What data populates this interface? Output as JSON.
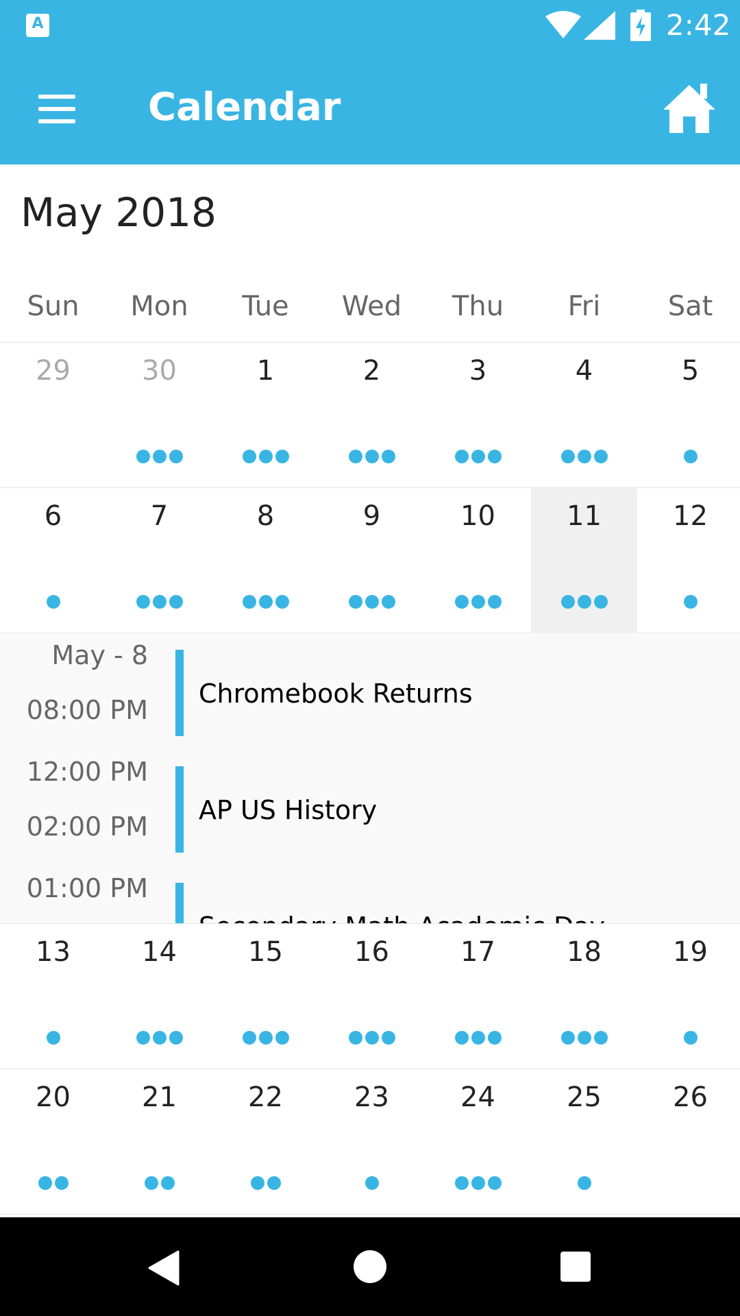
{
  "status_bar": {
    "app_icon_letter": "A",
    "time": "2:42",
    "icons": [
      "wifi-icon",
      "signal-icon",
      "battery-charging-icon"
    ]
  },
  "app_bar": {
    "title": "Calendar",
    "menu_icon": "hamburger-menu-icon",
    "home_icon": "home-icon"
  },
  "calendar": {
    "month_title": "May 2018",
    "weekdays": [
      "Sun",
      "Mon",
      "Tue",
      "Wed",
      "Thu",
      "Fri",
      "Sat"
    ],
    "weeks": [
      {
        "days": [
          {
            "n": "29",
            "dots": 0,
            "outside": true
          },
          {
            "n": "30",
            "dots": 3,
            "outside": true
          },
          {
            "n": "1",
            "dots": 3
          },
          {
            "n": "2",
            "dots": 3
          },
          {
            "n": "3",
            "dots": 3
          },
          {
            "n": "4",
            "dots": 3
          },
          {
            "n": "5",
            "dots": 1
          }
        ]
      },
      {
        "days": [
          {
            "n": "6",
            "dots": 1
          },
          {
            "n": "7",
            "dots": 3
          },
          {
            "n": "8",
            "dots": 3
          },
          {
            "n": "9",
            "dots": 3
          },
          {
            "n": "10",
            "dots": 3
          },
          {
            "n": "11",
            "dots": 3,
            "selected": true
          },
          {
            "n": "12",
            "dots": 1
          }
        ]
      },
      {
        "days": [
          {
            "n": "13",
            "dots": 1
          },
          {
            "n": "14",
            "dots": 3
          },
          {
            "n": "15",
            "dots": 3
          },
          {
            "n": "16",
            "dots": 3
          },
          {
            "n": "17",
            "dots": 3
          },
          {
            "n": "18",
            "dots": 3
          },
          {
            "n": "19",
            "dots": 1
          }
        ]
      },
      {
        "days": [
          {
            "n": "20",
            "dots": 2
          },
          {
            "n": "21",
            "dots": 2
          },
          {
            "n": "22",
            "dots": 2
          },
          {
            "n": "23",
            "dots": 1
          },
          {
            "n": "24",
            "dots": 3
          },
          {
            "n": "25",
            "dots": 1
          },
          {
            "n": "26",
            "dots": 0
          }
        ]
      }
    ]
  },
  "events": [
    {
      "time_start": "May - 8",
      "time_end": "08:00 PM",
      "title": "Chromebook Returns"
    },
    {
      "time_start": "12:00 PM",
      "time_end": "02:00 PM",
      "title": "AP US History"
    },
    {
      "time_start": "01:00 PM",
      "time_end": "",
      "title": "Secondary Math Academic Day"
    }
  ],
  "nav_bar": {
    "icons": [
      "back-icon",
      "home-circle-icon",
      "recent-apps-icon"
    ]
  },
  "colors": {
    "accent": "#39b5e3",
    "selected_day_bg": "#f0f0f0",
    "events_bg": "#f9f9f9"
  }
}
